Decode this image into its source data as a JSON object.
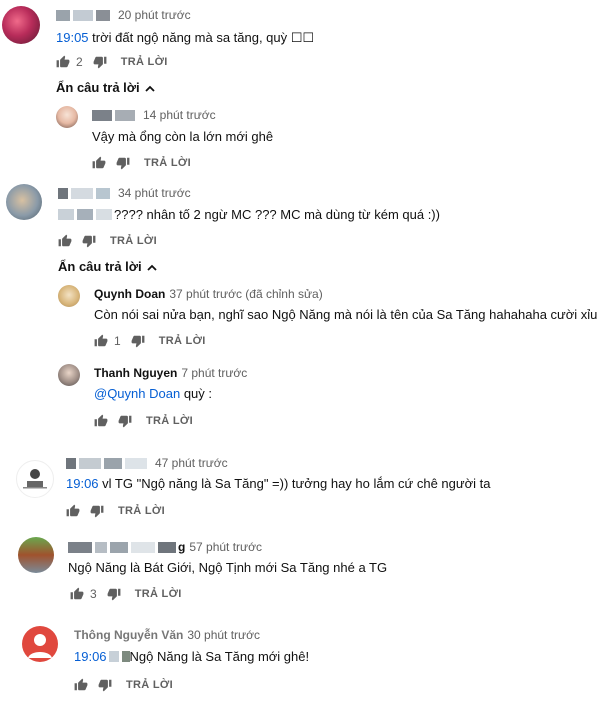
{
  "comments": [
    {
      "time": "20 phút trước",
      "timestamp": "19:05",
      "text": " trời đất ngộ năng mà sa tăng, quỳ ☐☐",
      "likes": "2",
      "reply_label": "TRẢ LỜI",
      "toggle_label": "Ẩn câu trả lời",
      "replies": [
        {
          "time": "14 phút trước",
          "text": "Vậy mà ổng còn la lớn mới ghê",
          "reply_label": "TRẢ LỜI"
        }
      ]
    },
    {
      "time": "34 phút trước",
      "text": "???? nhân tố 2 ngừ MC ??? MC mà dùng từ kém quá :))",
      "reply_label": "TRẢ LỜI",
      "toggle_label": "Ẩn câu trả lời",
      "replies": [
        {
          "author": "Quynh Doan",
          "time": "37 phút trước (đã chỉnh sửa)",
          "text": "Còn nói sai nửa bạn, nghĩ sao Ngộ Năng mà nói là tên của Sa Tăng hahahaha cười xỉu",
          "likes": "1",
          "reply_label": "TRẢ LỜI"
        },
        {
          "author": "Thanh Nguyen",
          "time": "7 phút trước",
          "mention": "@Quynh Doan",
          "text": " quỳ :",
          "reply_label": "TRẢ LỜI"
        }
      ]
    },
    {
      "time": "47 phút trước",
      "timestamp": "19:06",
      "text": " vl TG \"Ngộ năng là Sa Tăng\" =)) tưởng hay ho lắm cứ chê người ta",
      "reply_label": "TRẢ LỜI"
    },
    {
      "author_fragment": "g",
      "time": "57 phút trước",
      "text": "Ngộ Năng là Bát Giới, Ngộ Tịnh mới Sa Tăng nhé a TG",
      "likes": "3",
      "reply_label": "TRẢ LỜI"
    },
    {
      "author": "Thông Nguyễn Văn",
      "time": "30 phút trước",
      "timestamp": "19:06",
      "text": " Ngộ Năng là Sa Tăng mới ghê!",
      "reply_label": "TRẢ LỜI"
    }
  ],
  "colors": {
    "link": "#065fd4",
    "meta": "#606060",
    "text": "#111111",
    "avatar_default": "#e0483e"
  },
  "icons": [
    "thumb-up-icon",
    "thumb-down-icon",
    "chevron-up-icon",
    "default-avatar-icon"
  ]
}
